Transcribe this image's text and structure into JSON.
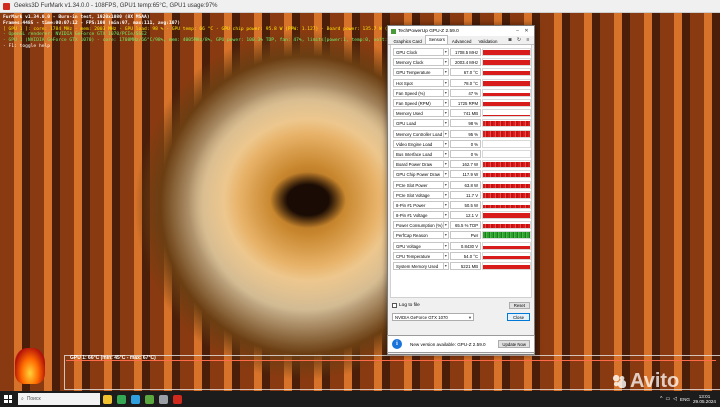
{
  "furmark": {
    "window_title": "Geeks3D FurMark v1.34.0.0 - 108FPS, GPU1 temp:65°C, GPU1 usage:97%",
    "overlay": [
      "FurMark v1.34.0.0 - Burn-in test, 1920x1080 (8X MSAA)",
      "Frames:4485 - time:00:07:12 - FPS:108 (min:97, max:111, avg:107)",
      "[ GPU 1 ]: core: 1784 MHz - mem: 2003 MHz - GPU load: 98 % - GPU temp: 66 °C - GPU chip power: 95.8 W (PPW: 1.127) - Board power: 135.7 W (PPW: 0.796) - GPU voltage: 0.800 V",
      "- OpenGL renderer: NVIDIA GeForce GTX 1070/PCIe/SSE2",
      "- GPU 1 (NVIDIA GeForce GTX 1070) - core: 1708MHz/66°C/98%, mem: 4005MHz/8%, GPU power: 100.3% TDP, fan: 47%, limits[power:1, temp:0, volt:0, OV:0]",
      "- F1: toggle help"
    ],
    "graph_label": "GPU 1: 66°C (min: 45°C - max: 67°C)"
  },
  "gpuz": {
    "title": "TechPowerUp GPU-Z 2.59.0",
    "tabs": [
      "Graphics Card",
      "Sensors",
      "Advanced",
      "Validation"
    ],
    "active_tab": "Sensors",
    "sensors": [
      {
        "name": "GPU Clock",
        "value": "1708.5 MHz",
        "level": 0.85,
        "style": "solid"
      },
      {
        "name": "Memory Clock",
        "value": "2003.4 MHz",
        "level": 0.85,
        "style": "solid"
      },
      {
        "name": "GPU Temperature",
        "value": "67.0 °C",
        "level": 0.7,
        "style": "solid"
      },
      {
        "name": "Hot Spot",
        "value": "78.0 °C",
        "level": 0.8,
        "style": "solid"
      },
      {
        "name": "Fan Speed (%)",
        "value": "47 %",
        "level": 0.55,
        "style": "solid"
      },
      {
        "name": "Fan Speed (RPM)",
        "value": "1725 RPM",
        "level": 0.6,
        "style": "solid"
      },
      {
        "name": "Memory Used",
        "value": "741 MB",
        "level": 0.25,
        "style": "solid"
      },
      {
        "name": "GPU Load",
        "value": "98 %",
        "level": 0.95,
        "style": "noisy"
      },
      {
        "name": "Memory Controller Load",
        "value": "95 %",
        "level": 0.9,
        "style": "noisy"
      },
      {
        "name": "Video Engine Load",
        "value": "0 %",
        "level": 0,
        "style": "solid"
      },
      {
        "name": "Bus Interface Load",
        "value": "0 %",
        "level": 0,
        "style": "solid"
      },
      {
        "name": "Board Power Draw",
        "value": "162.7 W",
        "level": 0.8,
        "style": "noisy"
      },
      {
        "name": "GPU Chip Power Draw",
        "value": "117.9 W",
        "level": 0.7,
        "style": "noisy"
      },
      {
        "name": "PCIe Slot Power",
        "value": "63.8 W",
        "level": 0.6,
        "style": "noisy"
      },
      {
        "name": "PCIe Slot Voltage",
        "value": "11.7 V",
        "level": 0.75,
        "style": "noisy"
      },
      {
        "name": "8-Pin #1 Power",
        "value": "50.5 W",
        "level": 0.55,
        "style": "noisy"
      },
      {
        "name": "8-Pin #1 Voltage",
        "value": "12.1 V",
        "level": 0.8,
        "style": "solid"
      },
      {
        "name": "Power Consumption (%)",
        "value": "65.5 % TDP",
        "level": 0.7,
        "style": "noisy"
      },
      {
        "name": "PerfCap Reason",
        "value": "Pwr",
        "level": 1,
        "style": "green"
      },
      {
        "name": "GPU Voltage",
        "value": "0.8430 V",
        "level": 0.5,
        "style": "solid"
      },
      {
        "name": "CPU Temperature",
        "value": "54.0 °C",
        "level": 0.55,
        "style": "solid"
      },
      {
        "name": "System Memory Used",
        "value": "5221 MB",
        "level": 0.6,
        "style": "solid"
      }
    ],
    "log_label": "Log to file",
    "reset_label": "Reset",
    "gpu_selected": "NVIDIA GeForce GTX 1070",
    "close_label": "Close"
  },
  "notification": {
    "icon": "i",
    "text": "New version available: GPU-Z 2.59.0",
    "button": "Update Now"
  },
  "taskbar": {
    "search_placeholder": "Поиск",
    "apps": [
      {
        "name": "explorer",
        "color": "#f2c12e"
      },
      {
        "name": "chrome",
        "color": "#34a853"
      },
      {
        "name": "edge",
        "color": "#2f9fe0"
      },
      {
        "name": "gpu-z",
        "color": "#5aa83e"
      },
      {
        "name": "steam",
        "color": "#9aa0a6"
      },
      {
        "name": "furmark",
        "color": "#d0291e"
      }
    ],
    "lang": "ENG",
    "time": "13:01",
    "date": "29.05.2024"
  },
  "watermark": "Avito"
}
